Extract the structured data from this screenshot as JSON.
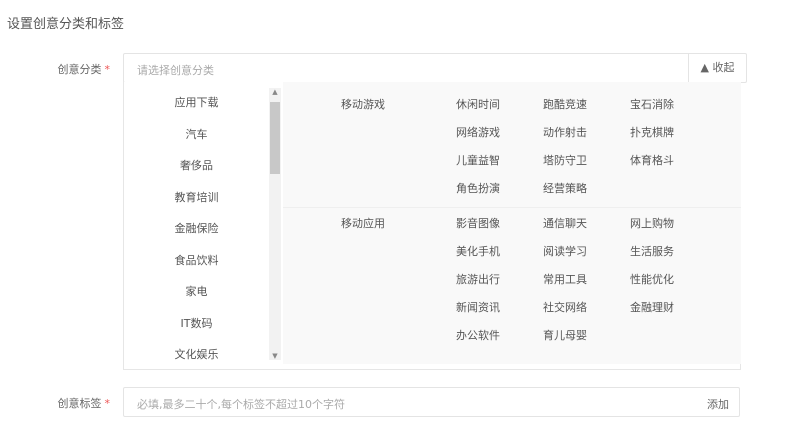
{
  "title": "设置创意分类和标签",
  "category": {
    "label": "创意分类",
    "required": "*",
    "placeholder": "请选择创意分类",
    "collapse_label": "▲ 收起"
  },
  "left_list": [
    "应用下载",
    "汽车",
    "奢侈品",
    "教育培训",
    "金融保险",
    "食品饮料",
    "家电",
    "IT数码",
    "文化娱乐"
  ],
  "groups": [
    {
      "name": "移动游戏",
      "items": [
        "休闲时间",
        "跑酷竞速",
        "宝石消除",
        "网络游戏",
        "动作射击",
        "扑克棋牌",
        "儿童益智",
        "塔防守卫",
        "体育格斗",
        "角色扮演",
        "经营策略"
      ]
    },
    {
      "name": "移动应用",
      "items": [
        "影音图像",
        "通信聊天",
        "网上购物",
        "美化手机",
        "阅读学习",
        "生活服务",
        "旅游出行",
        "常用工具",
        "性能优化",
        "新闻资讯",
        "社交网络",
        "金融理财",
        "办公软件",
        "育儿母婴"
      ]
    }
  ],
  "tags": {
    "label": "创意标签",
    "required": "*",
    "placeholder": "必填,最多二十个,每个标签不超过10个字符",
    "add_label": "添加"
  }
}
